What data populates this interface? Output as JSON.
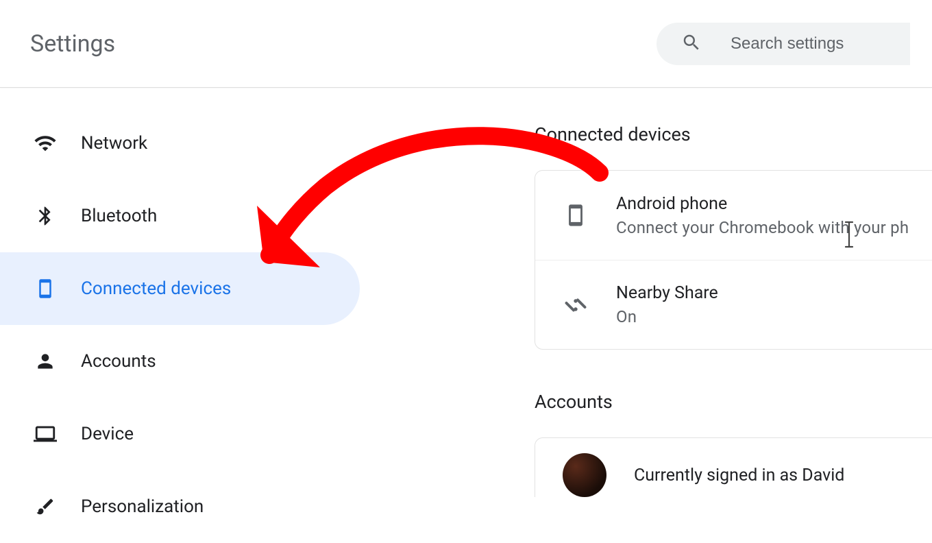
{
  "header": {
    "title": "Settings",
    "search_placeholder": "Search settings"
  },
  "sidebar": {
    "items": [
      {
        "id": "network",
        "label": "Network"
      },
      {
        "id": "bluetooth",
        "label": "Bluetooth"
      },
      {
        "id": "connected-devices",
        "label": "Connected devices"
      },
      {
        "id": "accounts",
        "label": "Accounts"
      },
      {
        "id": "device",
        "label": "Device"
      },
      {
        "id": "personalization",
        "label": "Personalization"
      }
    ],
    "selected_id": "connected-devices"
  },
  "main": {
    "connected_devices": {
      "title": "Connected devices",
      "android": {
        "title": "Android phone",
        "subtitle": "Connect your Chromebook with your ph"
      },
      "nearby_share": {
        "title": "Nearby Share",
        "status": "On"
      }
    },
    "accounts": {
      "title": "Accounts",
      "signed_in_text": "Currently signed in as David"
    }
  },
  "annotation": {
    "arrow_color": "#ff0000"
  }
}
